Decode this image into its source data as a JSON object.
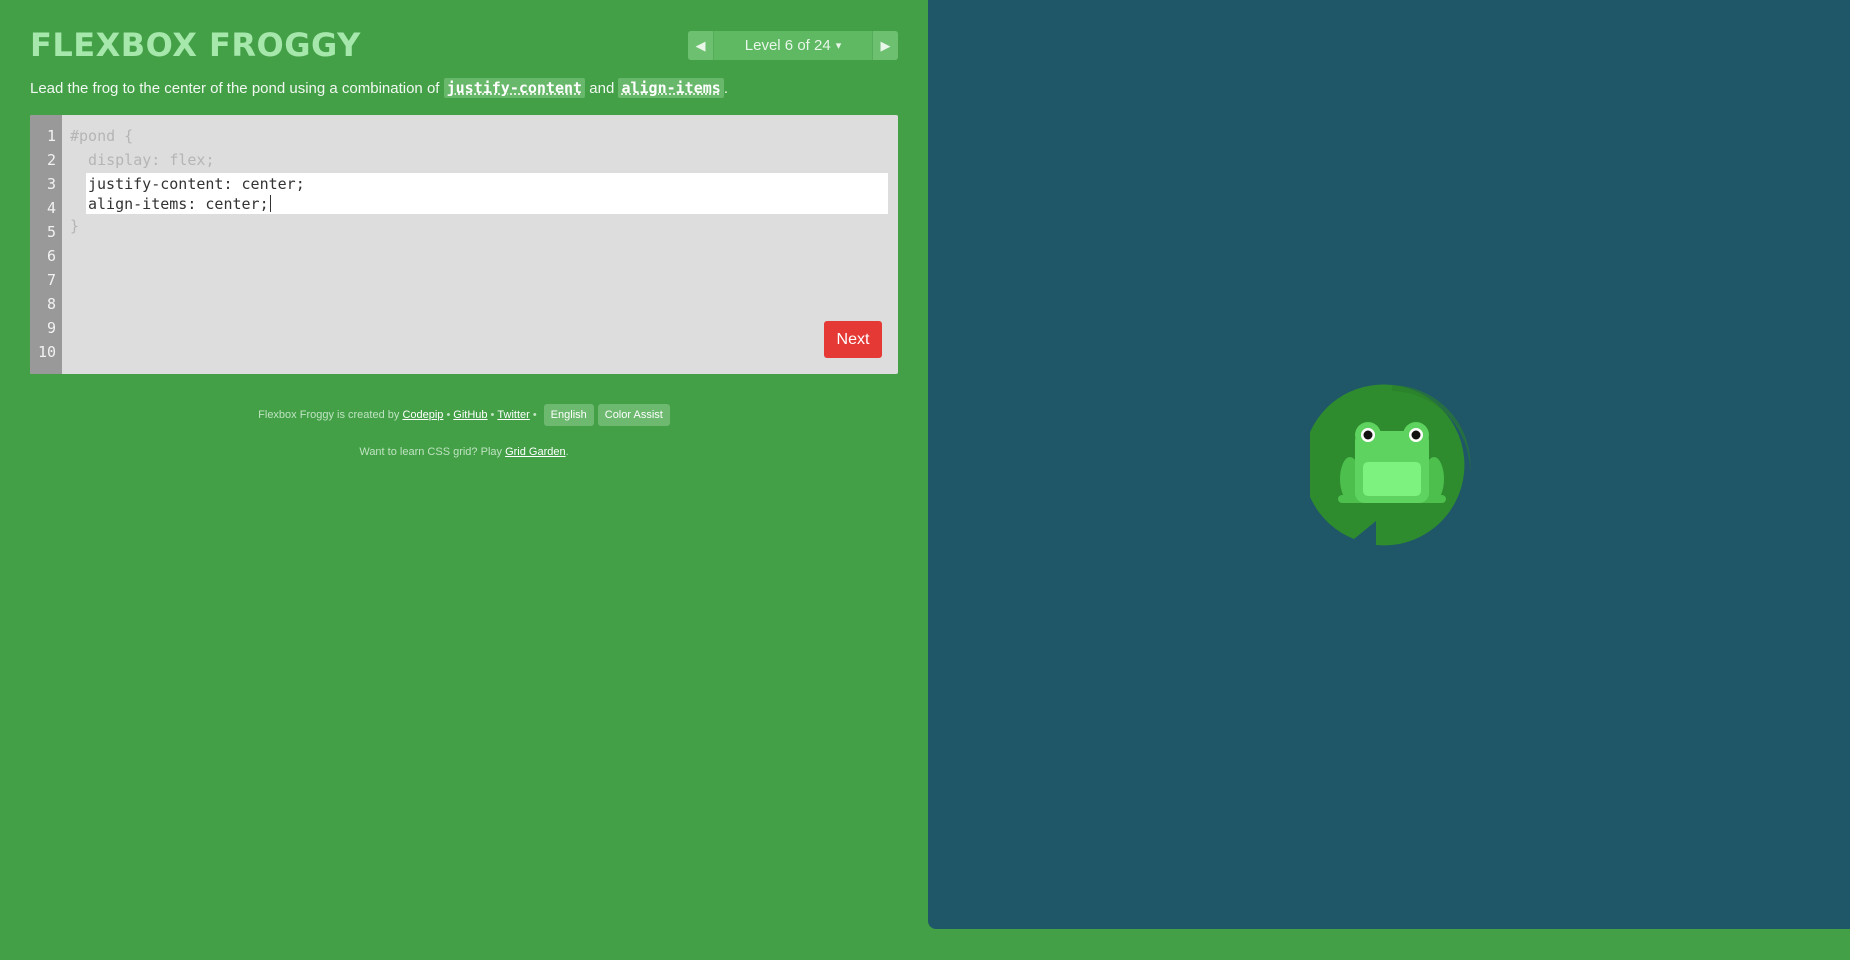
{
  "header": {
    "title": "FLEXBOX FROGGY"
  },
  "level_nav": {
    "prev_symbol": "◀",
    "next_symbol": "▶",
    "label": "Level 6 of 24",
    "caret": "▾"
  },
  "instructions": {
    "prefix": "Lead the frog to the center of the pond using a combination of ",
    "code1": "justify-content",
    "middle": " and ",
    "code2": "align-items",
    "suffix": "."
  },
  "editor": {
    "line_numbers": [
      "1",
      "2",
      "3",
      "4",
      "5",
      "6",
      "7",
      "8",
      "9",
      "10"
    ],
    "before_lines": [
      "#pond {",
      "  display: flex;"
    ],
    "answer_lines": [
      "justify-content: center;",
      "align-items: center;"
    ],
    "after_lines": [
      "}"
    ],
    "next_label": "Next"
  },
  "footer": {
    "credit_prefix": "Flexbox Froggy is created by ",
    "codepip": "Codepip",
    "sep": "•",
    "github": "GitHub",
    "twitter": "Twitter",
    "language_button": "English",
    "color_assist_button": "Color Assist",
    "promo_prefix": "Want to learn CSS grid? Play ",
    "promo_link": "Grid Garden",
    "promo_suffix": "."
  },
  "colors": {
    "sidebar_bg": "#43a047",
    "pond_bg": "#1f5768",
    "next_button": "#e53935",
    "lilypad": "#2e8b2e",
    "frog": "#5fd35f"
  },
  "icons": {
    "prev": "triangle-left-icon",
    "next": "triangle-right-icon",
    "dropdown": "caret-down-icon"
  }
}
